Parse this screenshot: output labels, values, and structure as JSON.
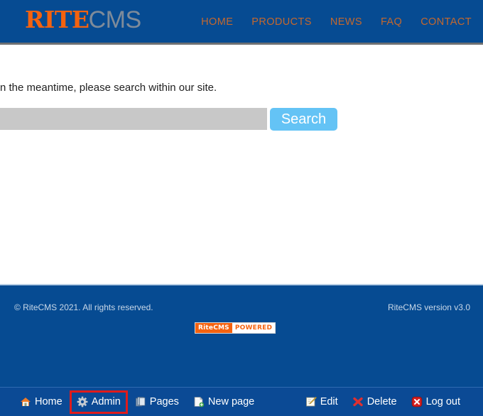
{
  "header": {
    "logo": {
      "part1": "RITE",
      "part2": "CMS"
    },
    "nav": [
      {
        "label": "HOME",
        "name": "nav-home"
      },
      {
        "label": "PRODUCTS",
        "name": "nav-products"
      },
      {
        "label": "NEWS",
        "name": "nav-news"
      },
      {
        "label": "FAQ",
        "name": "nav-faq"
      },
      {
        "label": "CONTACT",
        "name": "nav-contact"
      }
    ]
  },
  "main": {
    "message": "n the meantime, please search within our site.",
    "search": {
      "value": "",
      "placeholder": "",
      "button_label": "Search"
    }
  },
  "footer": {
    "copyright": "© RiteCMS 2021. All rights reserved.",
    "version": "RiteCMS version v3.0",
    "badge": {
      "left": "RiteCMS",
      "right": "POWERED"
    }
  },
  "toolbar": {
    "left_items": [
      {
        "label": "Home",
        "icon": "home-icon",
        "highlighted": false
      },
      {
        "label": "Admin",
        "icon": "gear-icon",
        "highlighted": true
      },
      {
        "label": "Pages",
        "icon": "pages-icon",
        "highlighted": false
      },
      {
        "label": "New page",
        "icon": "new-page-icon",
        "highlighted": false
      }
    ],
    "right_items": [
      {
        "label": "Edit",
        "icon": "edit-pencil-icon",
        "highlighted": false
      },
      {
        "label": "Delete",
        "icon": "red-x-icon",
        "highlighted": false
      },
      {
        "label": "Log out",
        "icon": "logout-icon",
        "highlighted": false
      }
    ]
  },
  "colors": {
    "brand_blue": "#064b92",
    "brand_orange": "#f4620f",
    "nav_link": "#c4682e",
    "search_button": "#64c3f5",
    "highlight_red": "#e01b1b"
  }
}
